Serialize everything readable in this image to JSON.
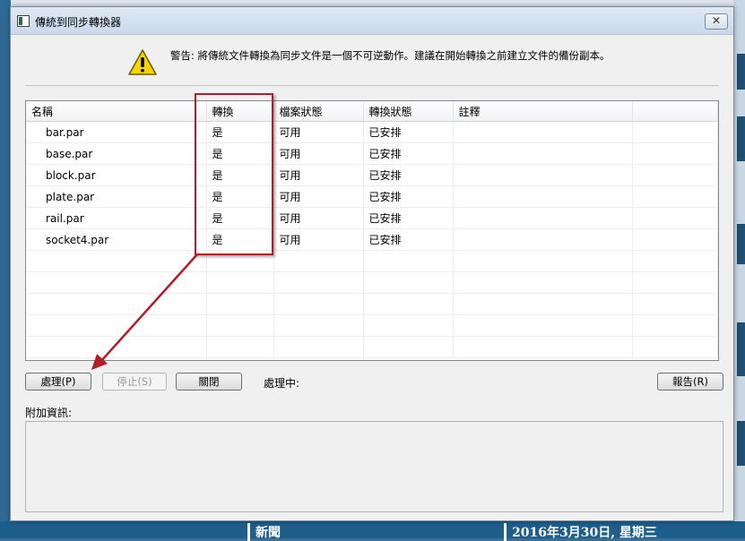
{
  "window": {
    "title": "傳統到同步轉換器",
    "close_symbol": "✕"
  },
  "warning": {
    "icon": "warning-triangle-icon",
    "text": "警告: 將傳統文件轉換為同步文件是一個不可逆動作。建議在開始轉換之前建立文件的備份副本。"
  },
  "table": {
    "headers": [
      "名稱",
      "轉換",
      "檔案狀態",
      "轉換狀態",
      "註釋"
    ],
    "rows": [
      {
        "name": "bar.par",
        "convert": "是",
        "file_status": "可用",
        "convert_status": "已安排",
        "comment": ""
      },
      {
        "name": "base.par",
        "convert": "是",
        "file_status": "可用",
        "convert_status": "已安排",
        "comment": ""
      },
      {
        "name": "block.par",
        "convert": "是",
        "file_status": "可用",
        "convert_status": "已安排",
        "comment": ""
      },
      {
        "name": "plate.par",
        "convert": "是",
        "file_status": "可用",
        "convert_status": "已安排",
        "comment": ""
      },
      {
        "name": "rail.par",
        "convert": "是",
        "file_status": "可用",
        "convert_status": "已安排",
        "comment": ""
      },
      {
        "name": "socket4.par",
        "convert": "是",
        "file_status": "可用",
        "convert_status": "已安排",
        "comment": ""
      }
    ],
    "empty_rows": 5
  },
  "buttons": {
    "process": "處理(P)",
    "stop": "停止(S)",
    "close": "關閉",
    "report": "報告(R)"
  },
  "status": {
    "label": "處理中:"
  },
  "additional_info": {
    "label": "附加資訊:"
  },
  "background": {
    "news_label": "新聞",
    "date_text": "2016年3月30日, 星期三"
  },
  "colors": {
    "highlight": "#b01e2a",
    "warning_yellow": "#f5d400"
  }
}
